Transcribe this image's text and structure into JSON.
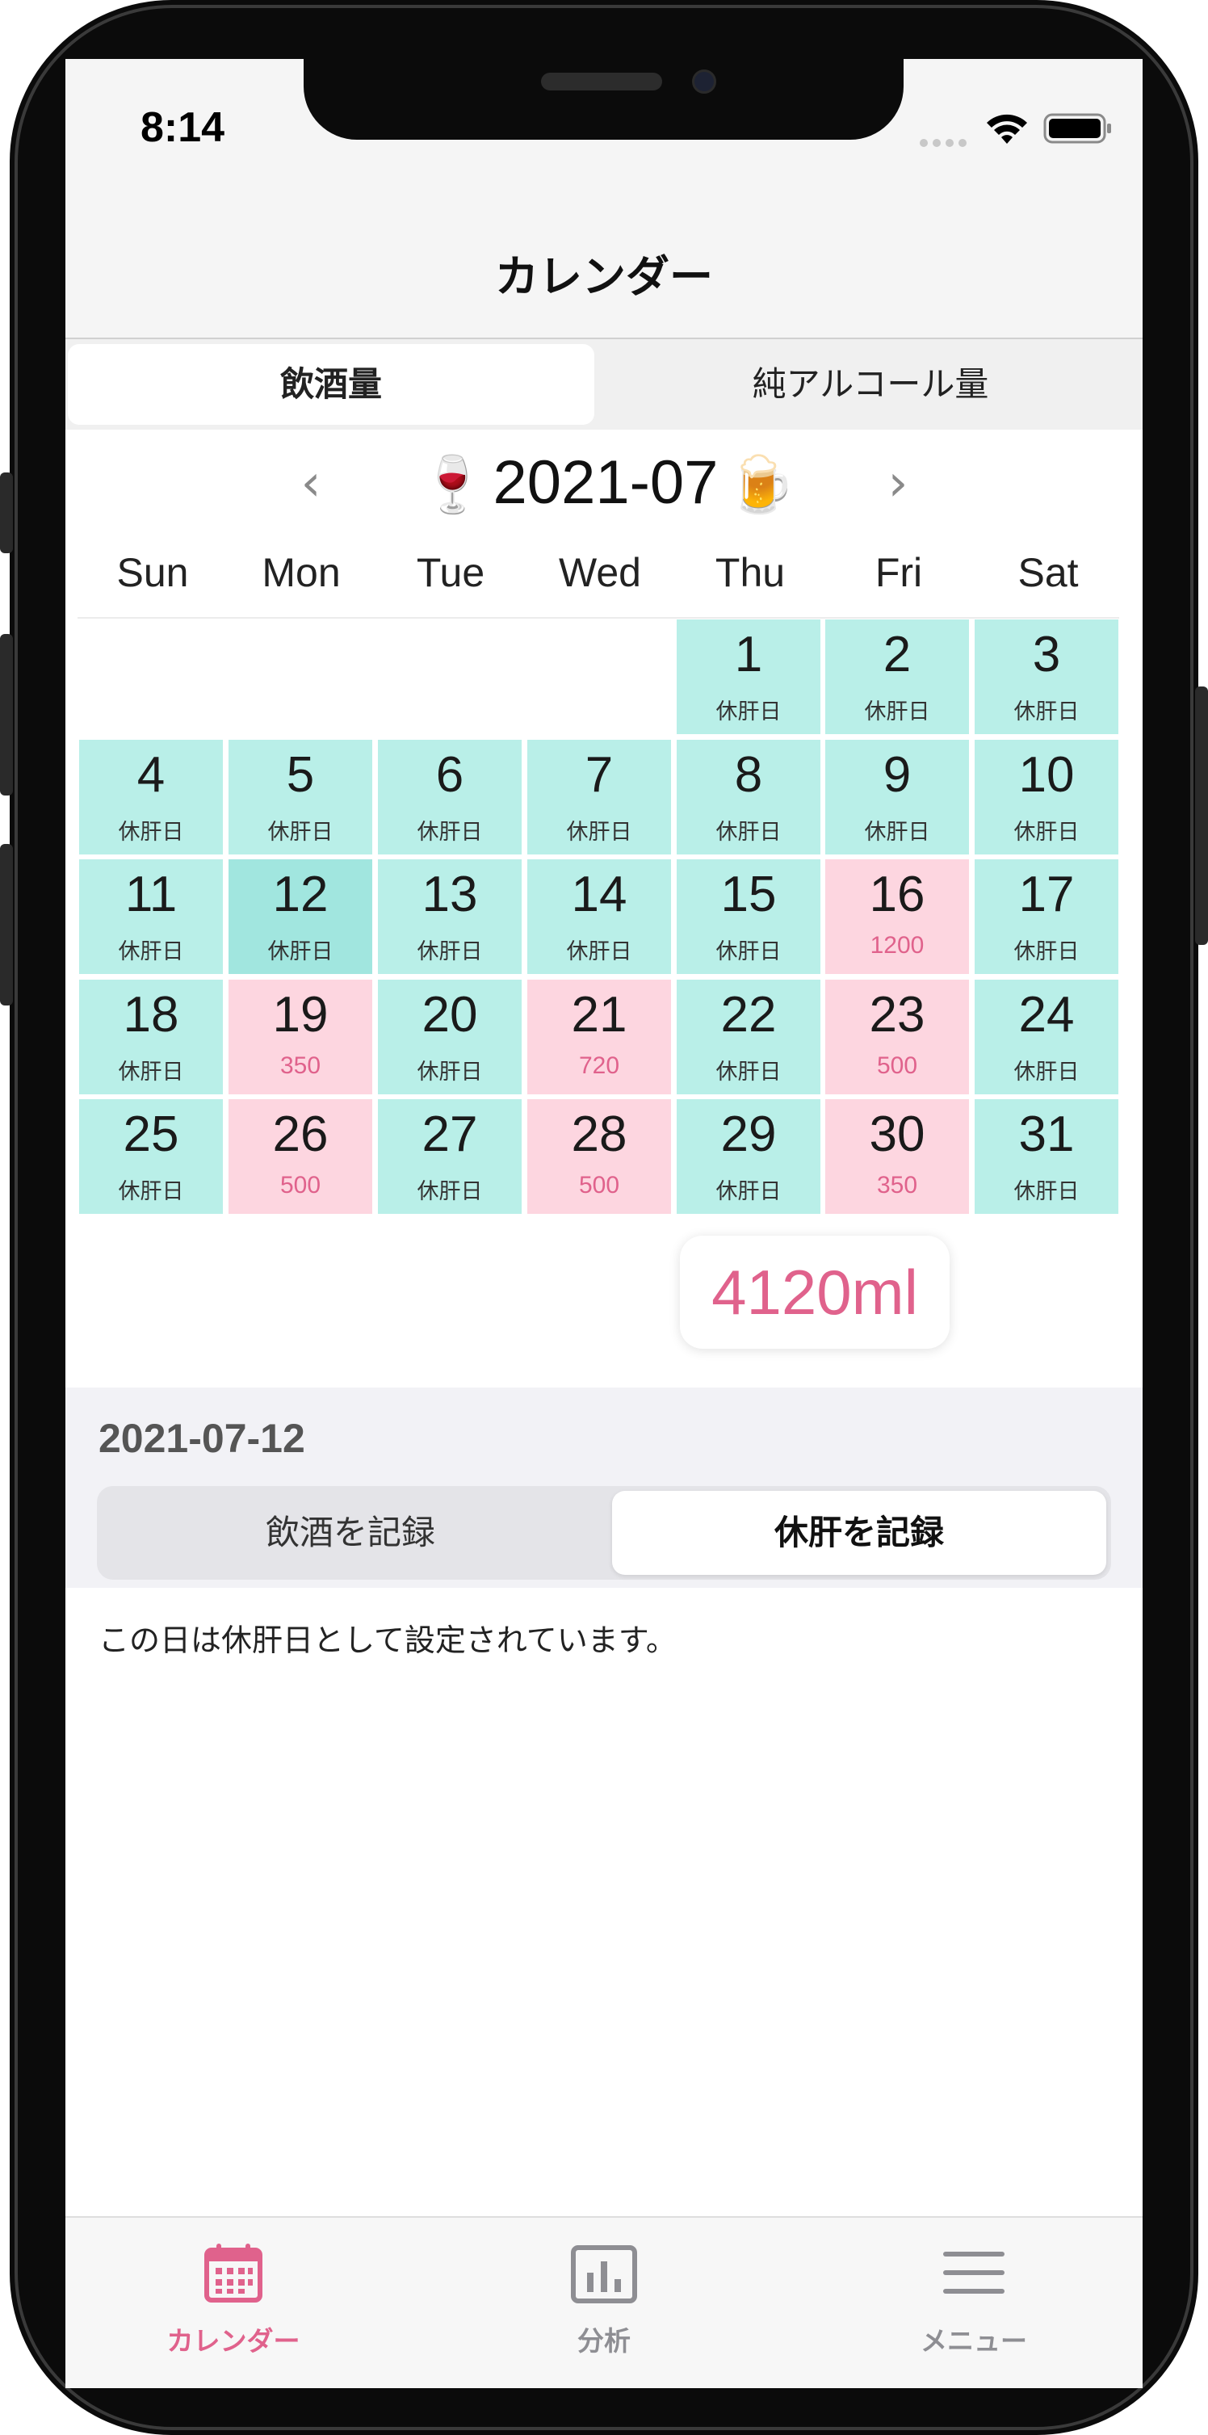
{
  "status_bar": {
    "time": "8:14"
  },
  "nav": {
    "title": "カレンダー"
  },
  "mode_tabs": [
    {
      "label": "飲酒量",
      "active": true
    },
    {
      "label": "純アルコール量",
      "active": false
    }
  ],
  "month": {
    "label": "2021-07",
    "left_emoji": "🍷",
    "right_emoji": "🍺",
    "prev": "‹",
    "next": "›"
  },
  "weekdays": [
    "Sun",
    "Mon",
    "Tue",
    "Wed",
    "Thu",
    "Fri",
    "Sat"
  ],
  "days": [
    {
      "day": "1",
      "note": "休肝日"
    },
    {
      "day": "2",
      "note": "休肝日"
    },
    {
      "day": "3",
      "note": "休肝日"
    },
    {
      "day": "4",
      "note": "休肝日"
    },
    {
      "day": "5",
      "note": "休肝日"
    },
    {
      "day": "6",
      "note": "休肝日"
    },
    {
      "day": "7",
      "note": "休肝日"
    },
    {
      "day": "8",
      "note": "休肝日"
    },
    {
      "day": "9",
      "note": "休肝日"
    },
    {
      "day": "10",
      "note": "休肝日"
    },
    {
      "day": "11",
      "note": "休肝日"
    },
    {
      "day": "12",
      "note": "休肝日"
    },
    {
      "day": "13",
      "note": "休肝日"
    },
    {
      "day": "14",
      "note": "休肝日"
    },
    {
      "day": "15",
      "note": "休肝日"
    },
    {
      "day": "16",
      "note": "1200"
    },
    {
      "day": "17",
      "note": "休肝日"
    },
    {
      "day": "18",
      "note": "休肝日"
    },
    {
      "day": "19",
      "note": "350"
    },
    {
      "day": "20",
      "note": "休肝日"
    },
    {
      "day": "21",
      "note": "720"
    },
    {
      "day": "22",
      "note": "休肝日"
    },
    {
      "day": "23",
      "note": "500"
    },
    {
      "day": "24",
      "note": "休肝日"
    },
    {
      "day": "25",
      "note": "休肝日"
    },
    {
      "day": "26",
      "note": "500"
    },
    {
      "day": "27",
      "note": "休肝日"
    },
    {
      "day": "28",
      "note": "500"
    },
    {
      "day": "29",
      "note": "休肝日"
    },
    {
      "day": "30",
      "note": "350"
    },
    {
      "day": "31",
      "note": "休肝日"
    }
  ],
  "total": "4120ml",
  "detail": {
    "date": "2021-07-12",
    "segments": [
      {
        "label": "飲酒を記録",
        "active": false
      },
      {
        "label": "休肝を記録",
        "active": true
      }
    ],
    "message": "この日は休肝日として設定されています。"
  },
  "bottom_tabs": [
    {
      "label": "カレンダー",
      "icon": "calendar-icon",
      "active": true
    },
    {
      "label": "分析",
      "icon": "chart-icon",
      "active": false
    },
    {
      "label": "メニュー",
      "icon": "menu-icon",
      "active": false
    }
  ],
  "colors": {
    "accent": "#e0628c",
    "rest_day": "#b9efe8",
    "drink_day": "#fdd6e0",
    "selected_day": "#a1e6df"
  }
}
